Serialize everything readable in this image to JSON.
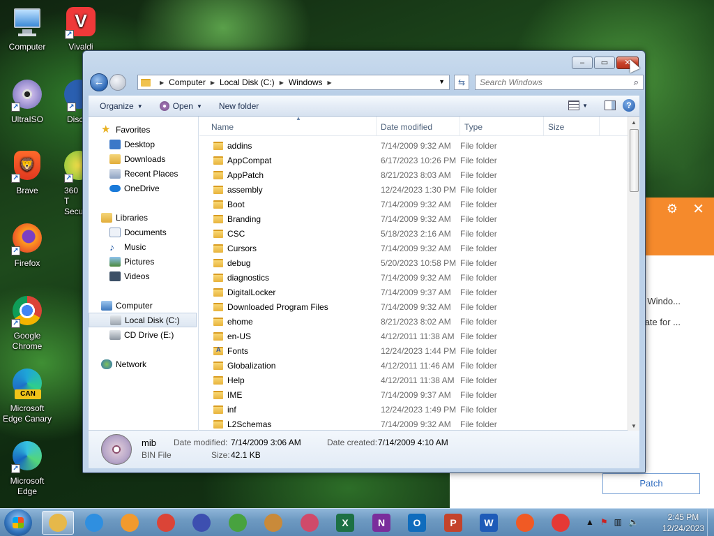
{
  "desktop": {
    "icons": [
      {
        "label": "Computer",
        "icon": "computer-icon"
      },
      {
        "label": "Vivaldi",
        "icon": "vivaldi-icon"
      },
      {
        "label": "UltraISO",
        "icon": "ultraiso-icon"
      },
      {
        "label": "Disc",
        "icon": "disc-icon"
      },
      {
        "label": "Brave",
        "icon": "brave-icon"
      },
      {
        "label": "360 T Secu",
        "icon": "360-security-icon"
      },
      {
        "label": "Firefox",
        "icon": "firefox-icon"
      },
      {
        "label": "Google Chrome",
        "icon": "chrome-icon"
      },
      {
        "label": "Microsoft Edge Canary",
        "icon": "edge-canary-icon",
        "badge": "CAN"
      },
      {
        "label": "Microsoft Edge",
        "icon": "edge-icon"
      }
    ]
  },
  "background_app": {
    "text1": "Windo...",
    "text2": "ate for ...",
    "patch_label": "Patch",
    "accent": "#f58a2c"
  },
  "window": {
    "address": {
      "crumbs": [
        "Computer",
        "Local Disk (C:)",
        "Windows"
      ]
    },
    "search_placeholder": "Search Windows",
    "toolbar": {
      "organize": "Organize",
      "open": "Open",
      "new_folder": "New folder"
    },
    "nav": {
      "favorites": "Favorites",
      "desktop": "Desktop",
      "downloads": "Downloads",
      "recent_places": "Recent Places",
      "onedrive": "OneDrive",
      "libraries": "Libraries",
      "documents": "Documents",
      "music": "Music",
      "pictures": "Pictures",
      "videos": "Videos",
      "computer": "Computer",
      "local_disk": "Local Disk (C:)",
      "cd_drive": "CD Drive (E:)",
      "network": "Network"
    },
    "columns": {
      "name": "Name",
      "date_modified": "Date modified",
      "type": "Type",
      "size": "Size"
    },
    "files": [
      {
        "name": "addins",
        "date": "7/14/2009 9:32 AM",
        "type": "File folder"
      },
      {
        "name": "AppCompat",
        "date": "6/17/2023 10:26 PM",
        "type": "File folder"
      },
      {
        "name": "AppPatch",
        "date": "8/21/2023 8:03 AM",
        "type": "File folder"
      },
      {
        "name": "assembly",
        "date": "12/24/2023 1:30 PM",
        "type": "File folder"
      },
      {
        "name": "Boot",
        "date": "7/14/2009 9:32 AM",
        "type": "File folder"
      },
      {
        "name": "Branding",
        "date": "7/14/2009 9:32 AM",
        "type": "File folder"
      },
      {
        "name": "CSC",
        "date": "5/18/2023 2:16 AM",
        "type": "File folder"
      },
      {
        "name": "Cursors",
        "date": "7/14/2009 9:32 AM",
        "type": "File folder"
      },
      {
        "name": "debug",
        "date": "5/20/2023 10:58 PM",
        "type": "File folder"
      },
      {
        "name": "diagnostics",
        "date": "7/14/2009 9:32 AM",
        "type": "File folder"
      },
      {
        "name": "DigitalLocker",
        "date": "7/14/2009 9:37 AM",
        "type": "File folder"
      },
      {
        "name": "Downloaded Program Files",
        "date": "7/14/2009 9:32 AM",
        "type": "File folder"
      },
      {
        "name": "ehome",
        "date": "8/21/2023 8:02 AM",
        "type": "File folder"
      },
      {
        "name": "en-US",
        "date": "4/12/2011 11:38 AM",
        "type": "File folder"
      },
      {
        "name": "Fonts",
        "date": "12/24/2023 1:44 PM",
        "type": "File folder",
        "special": "fonts"
      },
      {
        "name": "Globalization",
        "date": "4/12/2011 11:46 AM",
        "type": "File folder"
      },
      {
        "name": "Help",
        "date": "4/12/2011 11:38 AM",
        "type": "File folder"
      },
      {
        "name": "IME",
        "date": "7/14/2009 9:37 AM",
        "type": "File folder"
      },
      {
        "name": "inf",
        "date": "12/24/2023 1:49 PM",
        "type": "File folder"
      },
      {
        "name": "L2Schemas",
        "date": "7/14/2009 9:32 AM",
        "type": "File folder"
      }
    ],
    "details": {
      "name": "mib",
      "type": "BIN File",
      "date_modified_label": "Date modified:",
      "date_modified": "7/14/2009 3:06 AM",
      "size_label": "Size:",
      "size": "42.1 KB",
      "date_created_label": "Date created:",
      "date_created": "7/14/2009 4:10 AM"
    }
  },
  "taskbar": {
    "apps": [
      {
        "name": "file-explorer",
        "active": true,
        "color": "#e6b84a"
      },
      {
        "name": "internet-explorer",
        "color": "#2f8fe0"
      },
      {
        "name": "media-player",
        "color": "#f29a2e"
      },
      {
        "name": "chrome",
        "color": "#db4437"
      },
      {
        "name": "infinity-app",
        "color": "#3d4fb0"
      },
      {
        "name": "xbox-app",
        "color": "#48a23f"
      },
      {
        "name": "paint",
        "color": "#c98a3a"
      },
      {
        "name": "snipping",
        "color": "#d04a6a"
      },
      {
        "name": "excel",
        "color": "#1d7044",
        "glyph": "X"
      },
      {
        "name": "onenote",
        "color": "#7a2d9c",
        "glyph": "N"
      },
      {
        "name": "outlook",
        "color": "#0f6cbd",
        "glyph": "O"
      },
      {
        "name": "powerpoint",
        "color": "#c4432b",
        "glyph": "P"
      },
      {
        "name": "word",
        "color": "#1e5bb8",
        "glyph": "W"
      },
      {
        "name": "brave",
        "color": "#f05a24"
      },
      {
        "name": "vivaldi",
        "color": "#e53935"
      }
    ],
    "time": "2:45 PM",
    "date": "12/24/2023"
  }
}
